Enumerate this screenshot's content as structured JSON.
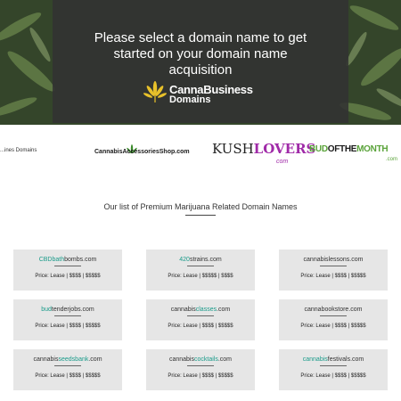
{
  "hero": {
    "title_line1": "Please select a domain name to get",
    "title_line2": "started on your domain name",
    "title_line3": "acquisition",
    "brand_line1": "CannaBusiness",
    "brand_line2": "Domains",
    "brand_icon": "cannabis-leaf-icon"
  },
  "partner_logos": {
    "logo1": "...ines Domains",
    "logo2": "CannabisAccessoriesShop.com",
    "logo3_prefix": "KUSH",
    "logo3_highlight": "LOVERS",
    "logo3_sub": "com",
    "logo4_prefix": "BUD",
    "logo4_mid": "OFTHE",
    "logo4_suffix": "MONTH",
    "logo4_domain": ".com"
  },
  "section": {
    "title": "Our list of Premium Marijuana Related Domain Names"
  },
  "domains": [
    {
      "pre": "",
      "hl": "CBDbath",
      "post": "bombs.com",
      "price": "Price: Lease | $$$$ | $$$$$"
    },
    {
      "pre": "",
      "hl": "420",
      "post": "strains.com",
      "price": "Price: Lease | $$$$$ | $$$$"
    },
    {
      "pre": "cannabis",
      "hl": "",
      "post": "lessons.com",
      "price": "Price: Lease | $$$$ | $$$$$"
    },
    {
      "pre": "",
      "hl": "bud",
      "post": "tenderjobs.com",
      "price": "Price: Lease | $$$$ | $$$$$"
    },
    {
      "pre": "cannabis",
      "hl": "classes",
      "post": ".com",
      "price": "Price: Lease | $$$$ | $$$$$"
    },
    {
      "pre": "canna",
      "hl": "",
      "post": "bookstore.com",
      "price": "Price: Lease | $$$$ | $$$$$"
    },
    {
      "pre": "cannabis",
      "hl": "seedsbank",
      "post": ".com",
      "price": "Price: Lease | $$$$ | $$$$$"
    },
    {
      "pre": "cannabis",
      "hl": "cocktails",
      "post": ".com",
      "price": "Price: Lease | $$$$ | $$$$$"
    },
    {
      "pre": "",
      "hl": "cannabis",
      "post": "festivals.com",
      "price": "Price: Lease | $$$$ | $$$$$"
    }
  ],
  "colors": {
    "accent": "#1a9b8a",
    "card_bg": "#e6e6e6",
    "hero_overlay": "#323232",
    "purple": "#a02aa8",
    "green": "#5aa33a"
  }
}
